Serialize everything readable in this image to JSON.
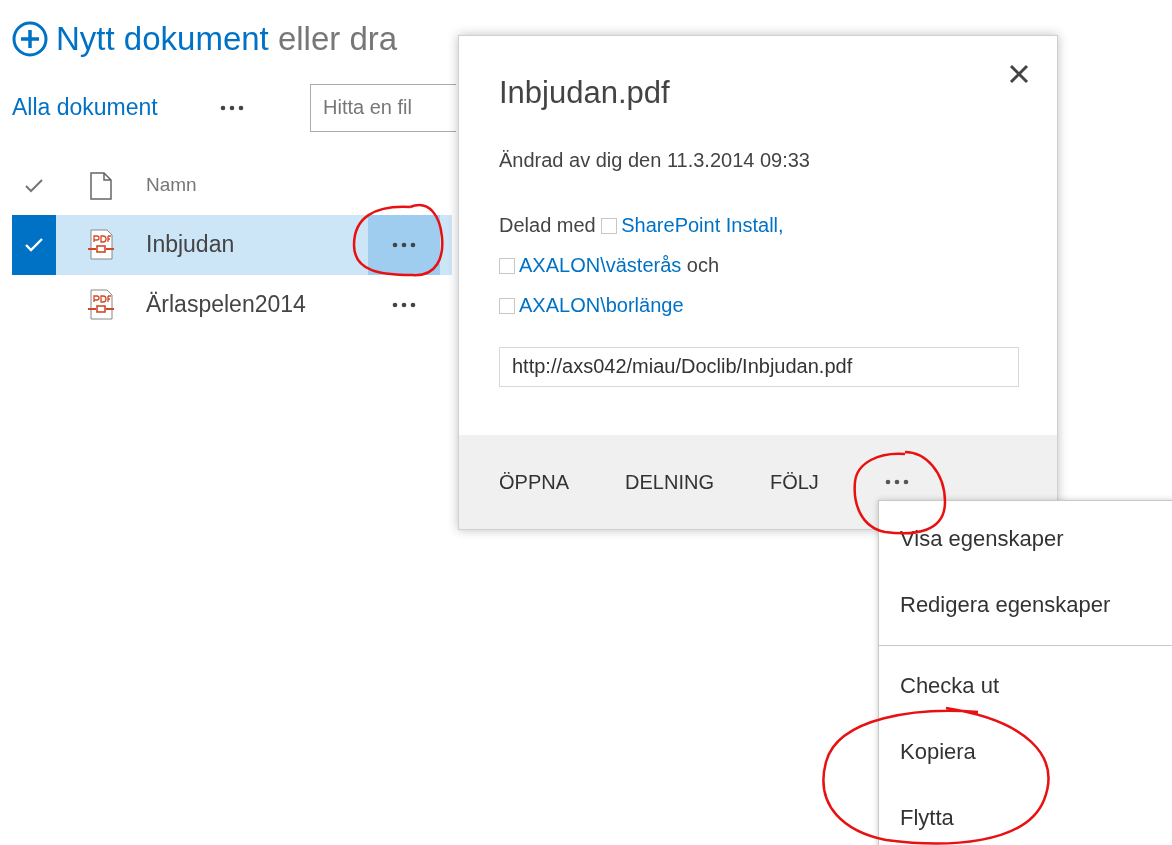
{
  "new_document": {
    "link": "Nytt dokument",
    "text": "eller dra"
  },
  "view": {
    "label": "Alla dokument"
  },
  "search": {
    "placeholder": "Hitta en fil"
  },
  "table": {
    "columns": [
      "Namn"
    ],
    "rows": [
      {
        "name": "Inbjudan",
        "selected": true
      },
      {
        "name": "Ärlaspelen2014",
        "selected": false
      }
    ]
  },
  "callout": {
    "title": "Inbjudan.pdf",
    "modified": "Ändrad av dig den 11.3.2014 09:33",
    "shared_label": "Delad med",
    "shared": [
      {
        "name": "SharePoint Install,"
      },
      {
        "name": "AXALON\\västerås",
        "after": "och"
      },
      {
        "name": "AXALON\\borlänge"
      }
    ],
    "url": "http://axs042/miau/Doclib/Inbjudan.pdf",
    "actions": [
      "ÖPPNA",
      "DELNING",
      "FÖLJ"
    ]
  },
  "menu": {
    "groups": [
      [
        "Visa egenskaper",
        "Redigera egenskaper"
      ],
      [
        "Checka ut",
        "Kopiera",
        "Flytta"
      ]
    ]
  }
}
